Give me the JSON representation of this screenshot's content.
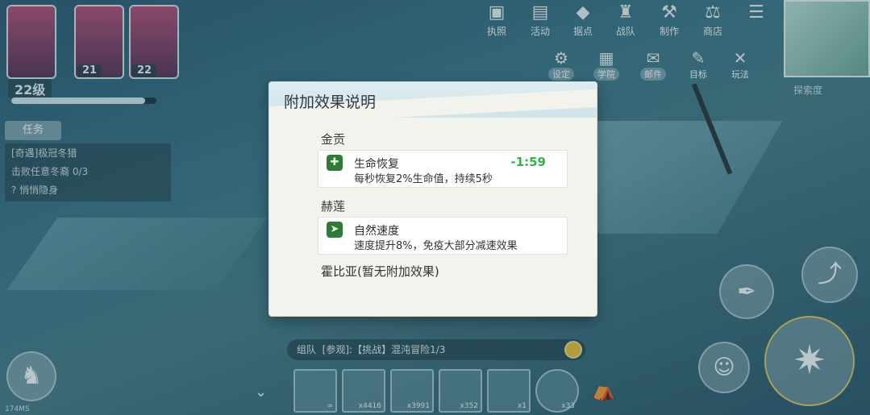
{
  "party": {
    "levels": [
      "21",
      "22"
    ],
    "player_level": "22级"
  },
  "quest": {
    "tab_label": "任务",
    "items": [
      "[奇遇]极冠冬猎",
      "击败任意冬裔 0/3",
      "? 悄悄隐身"
    ]
  },
  "top_menu": [
    {
      "label": "执照",
      "icon": "license-icon"
    },
    {
      "label": "活动",
      "icon": "gift-icon"
    },
    {
      "label": "据点",
      "icon": "stronghold-icon"
    },
    {
      "label": "战队",
      "icon": "team-icon"
    },
    {
      "label": "制作",
      "icon": "craft-icon"
    },
    {
      "label": "商店",
      "icon": "shop-icon"
    },
    {
      "label": "",
      "icon": "menu-icon"
    }
  ],
  "sub_menu": [
    {
      "label": "设定",
      "icon": "gear-icon"
    },
    {
      "label": "学院",
      "icon": "academy-icon"
    },
    {
      "label": "邮件",
      "icon": "mail-icon"
    },
    {
      "label": "目标",
      "icon": "target-icon"
    },
    {
      "label": "玩法",
      "icon": "swords-icon"
    }
  ],
  "minimap_label": "探索度",
  "chat": {
    "channel": "组队",
    "text": "[参观]:【挑战】混沌冒险1/3"
  },
  "hotbar": [
    "∞",
    "x4416",
    "x3991",
    "x352",
    "x1",
    "x33"
  ],
  "ping": "174MS",
  "modal": {
    "title": "附加效果说明",
    "sections": [
      {
        "name": "金贡",
        "effect_name": "生命恢复",
        "effect_desc": "每秒恢复2%生命值，持续5秒",
        "timer": "-1:59"
      },
      {
        "name": "赫莲",
        "effect_name": "自然速度",
        "effect_desc": "速度提升8%，免疫大部分减速效果",
        "timer": ""
      }
    ],
    "note": "霍比亚(暂无附加效果)"
  },
  "colors": {
    "accent": "#31b24a",
    "modal_bg": "#f2f3ed"
  }
}
